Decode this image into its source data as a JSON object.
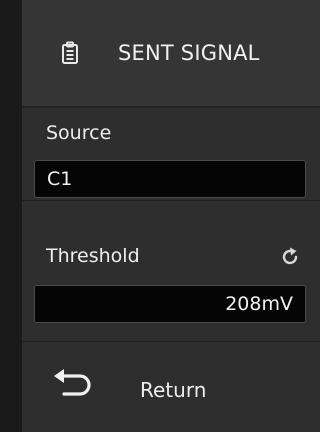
{
  "menu": {
    "title": "SENT SIGNAL",
    "title_icon": "document-icon"
  },
  "source": {
    "label": "Source",
    "value": "C1"
  },
  "threshold": {
    "label": "Threshold",
    "value": "208mV",
    "reset_icon": "refresh-icon"
  },
  "return": {
    "label": "Return",
    "icon": "return-arrow-icon"
  },
  "colors": {
    "panel_bg": "#2e2e2e",
    "field_bg": "#050505",
    "text": "#eeeeee"
  }
}
